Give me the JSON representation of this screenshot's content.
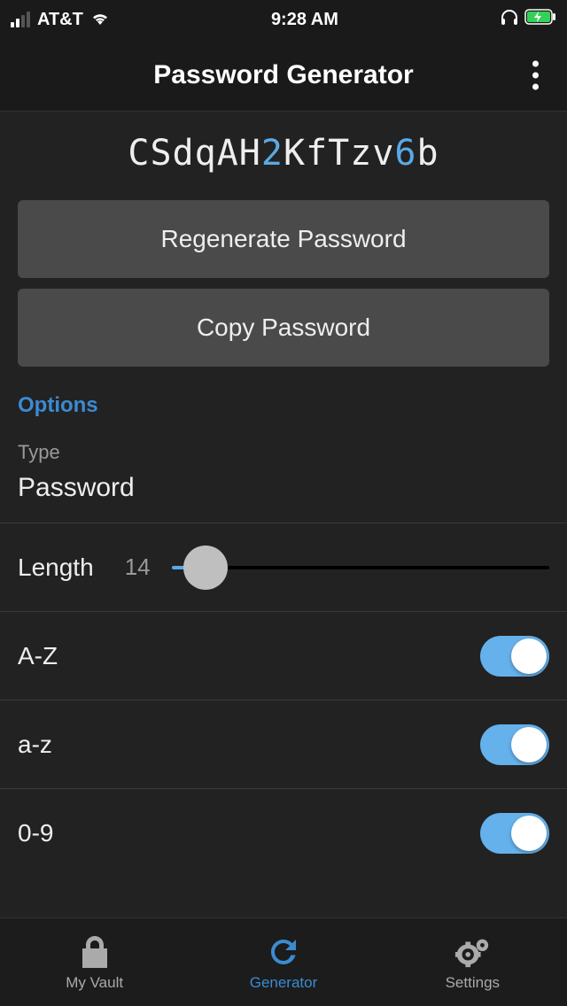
{
  "status": {
    "carrier": "AT&T",
    "time": "9:28 AM"
  },
  "header": {
    "title": "Password Generator"
  },
  "password": {
    "segments": [
      {
        "text": "CSdqAH",
        "kind": "alpha"
      },
      {
        "text": "2",
        "kind": "digit"
      },
      {
        "text": "KfTzv",
        "kind": "alpha"
      },
      {
        "text": "6",
        "kind": "digit"
      },
      {
        "text": "b",
        "kind": "alpha"
      }
    ]
  },
  "buttons": {
    "regenerate": "Regenerate Password",
    "copy": "Copy Password"
  },
  "options": {
    "section_label": "Options",
    "type_label": "Type",
    "type_value": "Password",
    "length_label": "Length",
    "length_value": "14",
    "toggles": [
      {
        "label": "A-Z",
        "on": true
      },
      {
        "label": "a-z",
        "on": true
      },
      {
        "label": "0-9",
        "on": true
      }
    ]
  },
  "nav": {
    "vault": "My Vault",
    "generator": "Generator",
    "settings": "Settings"
  },
  "colors": {
    "accent": "#3b8bd1",
    "digit": "#5aa9e6"
  }
}
